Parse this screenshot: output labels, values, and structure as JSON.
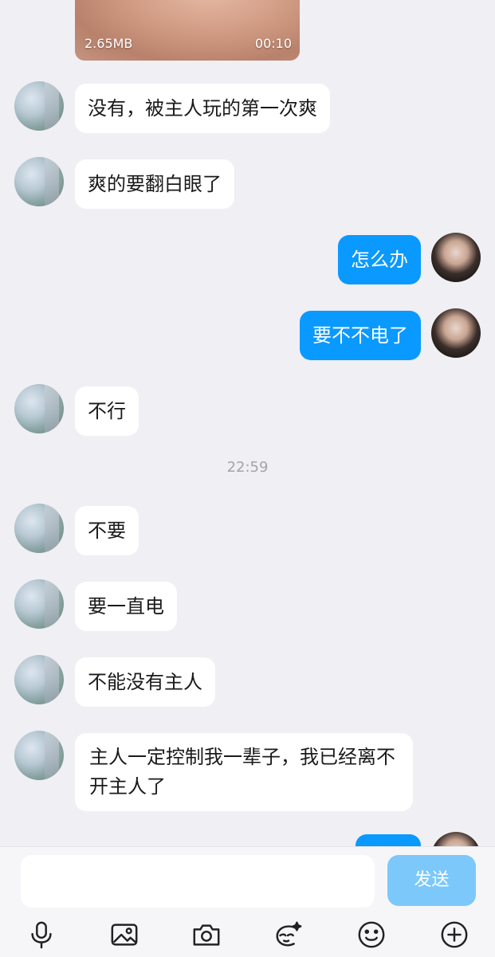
{
  "video": {
    "size": "2.65MB",
    "duration": "00:10"
  },
  "messages": [
    {
      "side": "in",
      "text": "没有，被主人玩的第一次爽"
    },
    {
      "side": "in",
      "text": "爽的要翻白眼了"
    },
    {
      "side": "out",
      "text": "怎么办"
    },
    {
      "side": "out",
      "text": "要不不电了"
    },
    {
      "side": "in",
      "text": "不行"
    },
    {
      "side": "in",
      "text": "不要"
    },
    {
      "side": "in",
      "text": "要一直电"
    },
    {
      "side": "in",
      "text": "不能没有主人"
    },
    {
      "side": "in",
      "text": "主人一定控制我一辈子，我已经离不开主人了"
    }
  ],
  "timestamp": "22:59",
  "input": {
    "value": "",
    "placeholder": ""
  },
  "send_label": "发送",
  "toolbar_icons": [
    "microphone-icon",
    "image-icon",
    "camera-icon",
    "sticker-icon",
    "emoji-icon",
    "plus-icon"
  ],
  "colors": {
    "outgoing_bubble": "#0a99ff",
    "incoming_bubble": "#ffffff",
    "send_button": "#7cc8fb",
    "background": "#efeff4"
  }
}
